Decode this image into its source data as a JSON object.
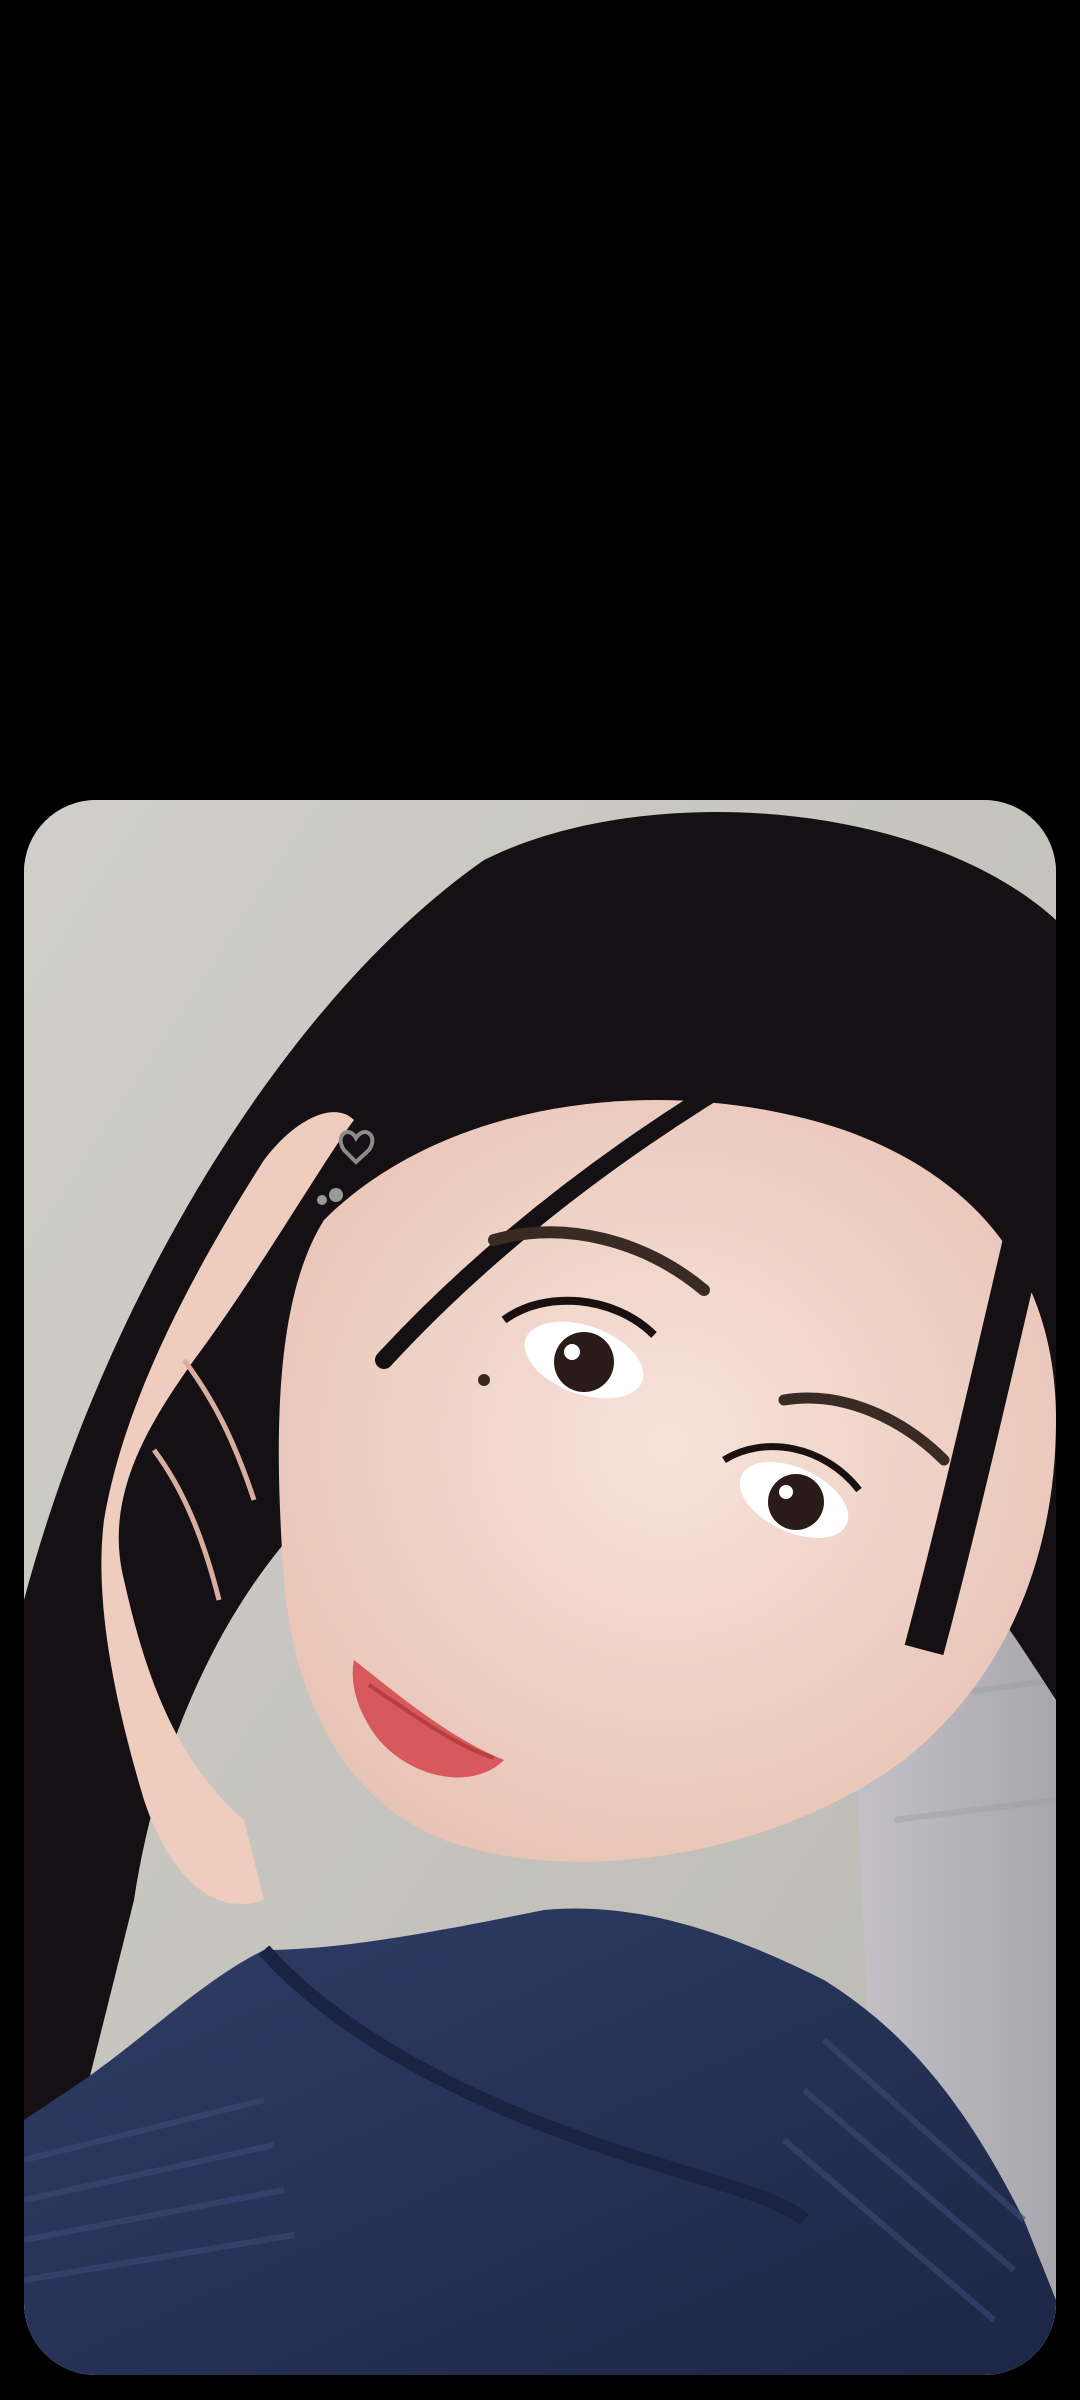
{
  "screen": {
    "background_color": "#000000"
  },
  "photo": {
    "subject": "selfie-photo",
    "colors": {
      "wall": "#c9c8c3",
      "curtain": "#b9b7bd",
      "hair": "#141014",
      "skin": "#f2d7cc",
      "sweater": "#27345a",
      "lips": "#d8595c"
    }
  }
}
